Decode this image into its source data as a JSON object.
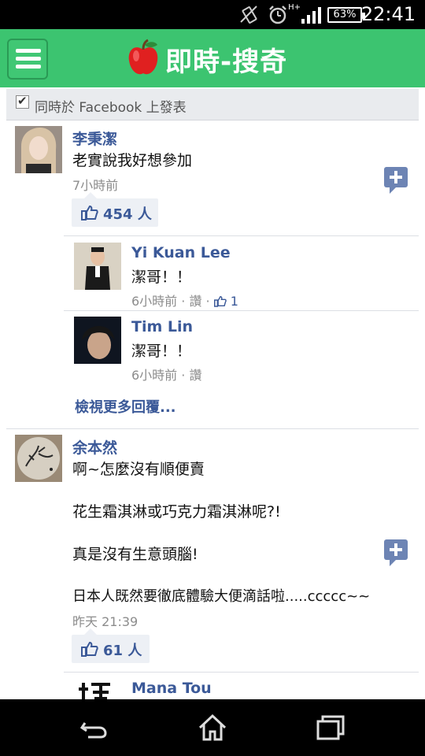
{
  "status_bar": {
    "time": "22:41",
    "battery": "63%",
    "network": "H+",
    "icons": [
      "vibrate-icon",
      "alarm-icon",
      "signal-icon",
      "battery-icon"
    ]
  },
  "app": {
    "title": "即時-搜奇",
    "accent_color": "#3cc470",
    "logo_icon": "apple-icon",
    "menu_icon": "hamburger-icon"
  },
  "facebook_share": {
    "label": "同時於 Facebook 上發表",
    "checked": true
  },
  "comments": [
    {
      "name": "李秉潔",
      "text": "老實說我好想參加",
      "time": "7小時前",
      "likes": "454 人",
      "replies": [
        {
          "name": "Yi Kuan Lee",
          "text": "潔哥！！",
          "time": "6小時前 · 讚 · ",
          "likes": "1"
        },
        {
          "name": "Tim Lin",
          "text": "潔哥！！",
          "time": "6小時前 · 讚"
        }
      ],
      "more_replies": "檢視更多回覆..."
    },
    {
      "name": "余本然",
      "lines": [
        "啊~怎麼沒有順便賣",
        "花生霜淇淋或巧克力霜淇淋呢?!",
        "真是沒有生意頭腦!",
        "日本人既然要徹底體驗大便滴話啦.....ccccc~~"
      ],
      "time": "昨天 21:39",
      "likes": "61 人",
      "replies": [
        {
          "name": "Mana Tou"
        }
      ]
    }
  ],
  "nav_bar": {
    "icons": [
      "back-icon",
      "home-icon",
      "recent-apps-icon"
    ]
  }
}
